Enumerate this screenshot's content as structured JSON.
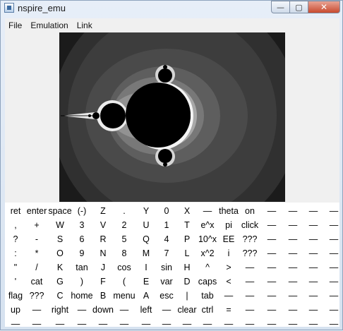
{
  "window": {
    "title": "nspire_emu",
    "caption": {
      "minimize": "—",
      "maximize": "▢",
      "close": "✕"
    }
  },
  "menu": [
    "File",
    "Emulation",
    "Link"
  ],
  "keypad": {
    "rows": [
      [
        "ret",
        "enter",
        "space",
        "(-)",
        "Z",
        ".",
        "Y",
        "0",
        "X",
        "—",
        "theta",
        "on",
        "—",
        "—",
        "—",
        "—"
      ],
      [
        ",",
        "+",
        "W",
        "3",
        "V",
        "2",
        "U",
        "1",
        "T",
        "e^x",
        "pi",
        "click",
        "—",
        "—",
        "—",
        "—"
      ],
      [
        "?",
        "-",
        "S",
        "6",
        "R",
        "5",
        "Q",
        "4",
        "P",
        "10^x",
        "EE",
        "???",
        "—",
        "—",
        "—",
        "—"
      ],
      [
        ":",
        "*",
        "O",
        "9",
        "N",
        "8",
        "M",
        "7",
        "L",
        "x^2",
        "i",
        "???",
        "—",
        "—",
        "—",
        "—"
      ],
      [
        "\"",
        "/",
        "K",
        "tan",
        "J",
        "cos",
        "I",
        "sin",
        "H",
        "^",
        ">",
        "—",
        "—",
        "—",
        "—",
        "—"
      ],
      [
        "'",
        "cat",
        "G",
        ")",
        "F",
        "(",
        "E",
        "var",
        "D",
        "caps",
        "<",
        "—",
        "—",
        "—",
        "—",
        "—"
      ],
      [
        "flag",
        "???",
        "C",
        "home",
        "B",
        "menu",
        "A",
        "esc",
        "|",
        "tab",
        "—",
        "—",
        "—",
        "—",
        "—",
        "—"
      ],
      [
        "up",
        "—",
        "right",
        "—",
        "down",
        "—",
        "left",
        "—",
        "clear",
        "ctrl",
        "=",
        "—",
        "—",
        "—",
        "—",
        "—"
      ],
      [
        "—",
        "—",
        "—",
        "—",
        "—",
        "—",
        "—",
        "—",
        "—",
        "—",
        "—",
        "—",
        "—",
        "—",
        "—",
        "—"
      ]
    ]
  },
  "icons": {
    "app": "app-icon"
  }
}
